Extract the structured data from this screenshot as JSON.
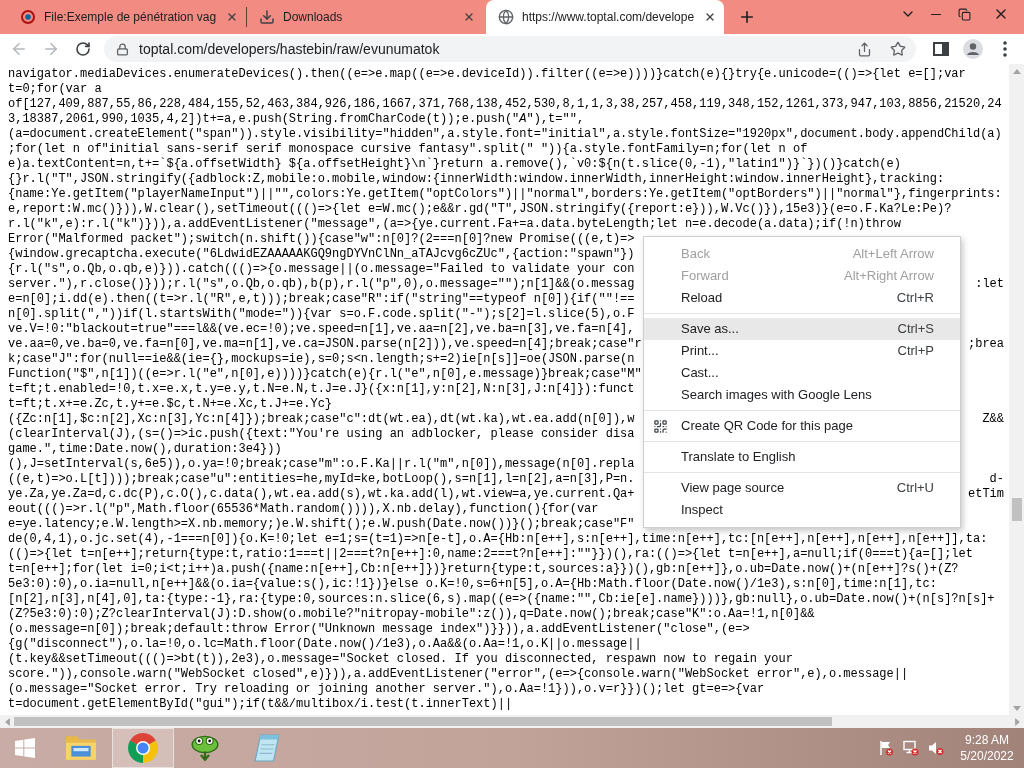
{
  "tabs": [
    {
      "title": "File:Exemple de pénétration vag",
      "selected": false
    },
    {
      "title": "Downloads",
      "selected": false
    },
    {
      "title": "https://www.toptal.com/develope",
      "selected": true
    }
  ],
  "toolbar": {
    "back": {
      "disabled": true
    },
    "forward": {
      "disabled": true
    },
    "url": "toptal.com/developers/hastebin/raw/evunumatok"
  },
  "code": {
    "lines": [
      {
        "text": "navigator.mediaDevices.enumerateDevices().then((e=>e.map((e=>e.deviceId)).filter((e=>e))))}catch(e){}try{e.unicode=(()=>{let e=[];var"
      },
      {
        "text": "t=0;for(var a"
      },
      {
        "text": "of[127,409,887,55,86,228,484,155,52,463,384,926,186,1667,371,768,138,452,530,8,1,1,3,38,257,458,119,348,152,1261,373,947,103,8856,21520,24"
      },
      {
        "text": "3,18387,2061,990,1035,4,2])t+=a,e.push(String.fromCharCode(t));e.push(\"*A*\"),t=\"\","
      },
      {
        "text": "(a=document.createElement(\"span\")).style.visibility=\"hidden\",a.style.font=\"initial\",a.style.fontSize=\"1920px\",document.body.appendChild(a)"
      },
      {
        "text": ";for(let n of\"initial sans-serif serif monospace cursive fantasy\".split(\" \")){a.style.fontFamily=n;for(let n of"
      },
      {
        "text": "e)a.textContent=n,t+=`${a.offsetWidth} ${a.offsetHeight}\\n`}return a.remove(),`v0:${n(t.slice(0,-1),\"latin1\")}`})()}catch(e)"
      },
      {
        "text": "{}r.l(\"T\",JSON.stringify({adblock:Z,mobile:o.mobile,window:{innerWidth:window.innerWidth,innerHeight:window.innerHeight},tracking:"
      },
      {
        "text": "{name:Ye.getItem(\"playerNameInput\")||\"\",colors:Ye.getItem(\"optColors\")||\"normal\",borders:Ye.getItem(\"optBorders\")||\"normal\"},fingerprints:"
      },
      {
        "text": "e,report:W.mc()})),W.clear(),setTimeout((()=>{let e=W.mc();e&&r.gd(\"T\",JSON.stringify({report:e})),W.Vc()}),15e3)}(e=o.F.Ka?Le:Pe)?"
      },
      {
        "text": "r.l(\"k\",e):r.l(\"k\")})),a.addEventListener(\"message\",(a=>{ye.current.Fa+=a.data.byteLength;let n=e.decode(a.data);if(!n)throw"
      },
      {
        "text": "Error(\"Malformed packet\");switch(n.shift()){case\"w\":n[0]?(2===n[0]?new Promise(((e,t)=>"
      },
      {
        "text": "{window.grecaptcha.execute(\"6LdwidEZAAAAAKGQ9ngDYVnClNn_aTAJcvg6cZUc\",{action:\"spawn\"})"
      },
      {
        "text": "{r.l(\"s\",o.Qb,o.qb,e)})).catch((()=>{o.message||(o.message=\"Failed to validate your con"
      },
      {
        "text": "server.\"),r.close()}));r.l(\"s\",o.Qb,o.qb),b(p),r.l(\"p\",0),o.message=\"\");n[1]&&(o.messag",
        "right": ":let"
      },
      {
        "text": "e=n[0];i.dd(e).then((t=>r.l(\"R\",e,t)));break;case\"R\":if(\"string\"==typeof n[0]){if(\"\"!=="
      },
      {
        "text": "n[0].split(\",\"))if(l.startsWith(\"mode=\")){var s=o.F.code.split(\"-\");s[2]=l.slice(5),o.F"
      },
      {
        "text": "ve.V=!0:\"blackout=true\"===l&&(ve.ec=!0);ve.speed=n[1],ve.aa=n[2],ve.ba=n[3],ve.fa=n[4],"
      },
      {
        "text": "ve.aa=0,ve.ba=0,ve.fa=n[0],ve.ma=n[1],ve.ca=JSON.parse(n[2])),ve.speed=n[4];break;case\"r",
        "right": ";brea"
      },
      {
        "text": "k;case\"J\":for(null==ie&&(ie={},mockups=ie),s=0;s<n.length;s+=2)ie[n[s]]=oe(JSON.parse(n"
      },
      {
        "text": "Function(\"$\",n[1])((e=>r.l(\"e\",n[0],e))))}catch(e){r.l(\"e\",n[0],e.message)}break;case\"M\""
      },
      {
        "text": "t=ft;t.enabled=!0,t.x=e.x,t.y=e.y,t.N=e.N,t.J=e.J}({x:n[1],y:n[2],N:n[3],J:n[4]}):funct"
      },
      {
        "text": "t=ft;t.x+=e.Zc,t.y+=e.$c,t.N+=e.Xc,t.J+=e.Yc}"
      },
      {
        "text": "({Zc:n[1],$c:n[2],Xc:n[3],Yc:n[4]});break;case\"c\":dt(wt.ea),dt(wt.ka),wt.ea.add(n[0]),w",
        "right": "Z&&"
      },
      {
        "text": "(clearInterval(J),(s=()=>ic.push({text:\"You're using an adblocker, please consider disa"
      },
      {
        "text": "game.\",time:Date.now(),duration:3e4}))"
      },
      {
        "text": "(),J=setInterval(s,6e5)),o.ya=!0;break;case\"m\":o.F.Ka||r.l(\"m\",n[0]),message(n[0].repla"
      },
      {
        "text": "((e,t)=>o.L[t])));break;case\"u\":entities=he,myId=ke,botLoop(),s=n[1],l=n[2],a=n[3],P=n.",
        "right": "d-"
      },
      {
        "text": "ye.Za,ye.Za=d,c.dc(P),c.O(),c.data(),wt.ea.add(s),wt.ka.add(l),wt.view=a,ye.current.Qa+",
        "right": "etTim"
      },
      {
        "text": "eout((()=>r.l(\"p\",Math.floor(65536*Math.random()))),X.nb.delay),function(){for(var"
      },
      {
        "text": "e=ye.latency;e.W.length>=X.nb.memory;)e.W.shift();e.W.push(Date.now())}();break;case\"F\""
      },
      {
        "text": "de(0,4,1),o.jc.set(4),-1===n[0]){o.K=!0;let e=1;s=(t=1)=>n[e-t],o.A={Hb:n[e++],s:n[e++],time:n[e++],tc:[n[e++],n[e++],n[e++],n[e++]],ta:"
      },
      {
        "text": "(()=>{let t=n[e++];return{type:t,ratio:1===t||2===t?n[e++]:0,name:2===t?n[e++]:\"\"}})(),ra:(()=>{let t=n[e++],a=null;if(0===t){a=[];let"
      },
      {
        "text": "t=n[e++];for(let i=0;i<t;i++)a.push({name:n[e++],Cb:n[e++]})}return{type:t,sources:a}})(),gb:n[e++]},o.ub=Date.now()+(n[e++]?s()+(Z?"
      },
      {
        "text": "5e3:0):0),o.ia=null,n[e++]&&(o.ia={value:s(),ic:!1})}else o.K=!0,s=6+n[5],o.A={Hb:Math.floor(Date.now()/1e3),s:n[0],time:n[1],tc:"
      },
      {
        "text": "[n[2],n[3],n[4],0],ta:{type:-1},ra:{type:0,sources:n.slice(6,s).map((e=>({name:\"\",Cb:ie[e].name})))},gb:null},o.ub=Date.now()+(n[s]?n[s]+"
      },
      {
        "text": "(Z?5e3:0):0);Z?clearInterval(J):D.show(o.mobile?\"nitropay-mobile\":z()),q=Date.now();break;case\"K\":o.Aa=!1,n[0]&&"
      },
      {
        "text": "(o.message=n[0]);break;default:throw Error(\"Unknown message index\")}})),a.addEventListener(\"close\",(e=>"
      },
      {
        "text": "{g(\"disconnect\"),o.la=!0,o.lc=Math.floor(Date.now()/1e3),o.Aa&&(o.Aa=!1,o.K||o.message||"
      },
      {
        "text": "(t.key&&setTimeout((()=>bt(t)),2e3),o.message=\"Socket closed. If you disconnected, respawn now to regain your"
      },
      {
        "text": "score.\")),console.warn(\"WebSocket closed\",e)})),a.addEventListener(\"error\",(e=>{console.warn(\"WebSocket error\",e),o.message||"
      },
      {
        "text": "(o.message=\"Socket error. Try reloading or joining another server.\"),o.Aa=!1})),o.v=r}})();let gt=e=>{var"
      },
      {
        "text": "t=document.getElementById(\"gui\");if(t&&/multibox/i.test(t.innerText)||"
      }
    ]
  },
  "context_menu": {
    "groups": [
      {
        "items": [
          {
            "label": "Back",
            "shortcut": "Alt+Left Arrow",
            "disabled": true,
            "highlighted": false,
            "has_icon": false
          },
          {
            "label": "Forward",
            "shortcut": "Alt+Right Arrow",
            "disabled": true,
            "highlighted": false,
            "has_icon": false
          },
          {
            "label": "Reload",
            "shortcut": "Ctrl+R",
            "disabled": false,
            "highlighted": false,
            "has_icon": false
          }
        ]
      },
      {
        "items": [
          {
            "label": "Save as...",
            "shortcut": "Ctrl+S",
            "disabled": false,
            "highlighted": true,
            "has_icon": false
          },
          {
            "label": "Print...",
            "shortcut": "Ctrl+P",
            "disabled": false,
            "highlighted": false,
            "has_icon": false
          },
          {
            "label": "Cast...",
            "disabled": false,
            "highlighted": false,
            "has_icon": false
          },
          {
            "label": "Search images with Google Lens",
            "disabled": false,
            "highlighted": false,
            "has_icon": false
          }
        ]
      },
      {
        "items": [
          {
            "label": "Create QR Code for this page",
            "disabled": false,
            "highlighted": false,
            "has_icon": true
          }
        ]
      },
      {
        "items": [
          {
            "label": "Translate to English",
            "disabled": false,
            "highlighted": false,
            "has_icon": false
          }
        ]
      },
      {
        "items": [
          {
            "label": "View page source",
            "shortcut": "Ctrl+U",
            "disabled": false,
            "highlighted": false,
            "has_icon": false
          },
          {
            "label": "Inspect",
            "disabled": false,
            "highlighted": false,
            "has_icon": false
          }
        ]
      }
    ]
  },
  "taskbar": {
    "apps": [
      {
        "active": false
      },
      {
        "active": true
      },
      {
        "active": false
      },
      {
        "active": false
      }
    ],
    "clock": {
      "time": "9:28 AM",
      "date": "5/20/2022"
    }
  }
}
